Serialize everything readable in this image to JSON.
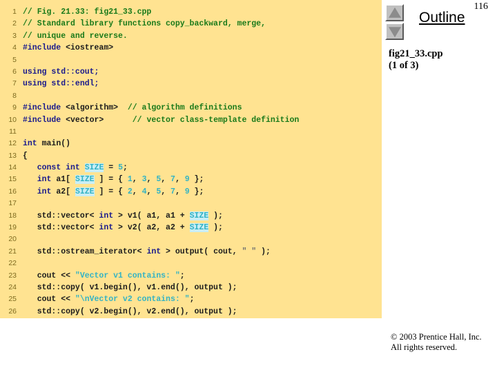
{
  "page_number": "116",
  "code_panel": {
    "background": "#ffe391",
    "lines": [
      {
        "n": "1",
        "segments": [
          {
            "t": "// Fig. 21.33: fig21_33.cpp",
            "c": "comment"
          }
        ]
      },
      {
        "n": "2",
        "segments": [
          {
            "t": "// Standard library functions copy_backward, merge,",
            "c": "comment"
          }
        ]
      },
      {
        "n": "3",
        "segments": [
          {
            "t": "// unique and reverse.",
            "c": "comment"
          }
        ]
      },
      {
        "n": "4",
        "segments": [
          {
            "t": "#include",
            "c": "pre"
          },
          {
            "t": " <iostream>",
            "c": "plain"
          }
        ]
      },
      {
        "n": "5",
        "segments": []
      },
      {
        "n": "6",
        "segments": [
          {
            "t": "using std::cout;",
            "c": "kw"
          }
        ]
      },
      {
        "n": "7",
        "segments": [
          {
            "t": "using std::endl;",
            "c": "kw"
          }
        ]
      },
      {
        "n": "8",
        "segments": []
      },
      {
        "n": "9",
        "segments": [
          {
            "t": "#include",
            "c": "pre"
          },
          {
            "t": " <algorithm>  ",
            "c": "plain"
          },
          {
            "t": "// algorithm definitions",
            "c": "comment"
          }
        ]
      },
      {
        "n": "10",
        "segments": [
          {
            "t": "#include",
            "c": "pre"
          },
          {
            "t": " <vector>      ",
            "c": "plain"
          },
          {
            "t": "// vector class-template definition",
            "c": "comment"
          }
        ]
      },
      {
        "n": "11",
        "segments": []
      },
      {
        "n": "12",
        "segments": [
          {
            "t": "int",
            "c": "kw"
          },
          {
            "t": " main()",
            "c": "plain"
          }
        ]
      },
      {
        "n": "13",
        "segments": [
          {
            "t": "{",
            "c": "plain"
          }
        ]
      },
      {
        "n": "14",
        "segments": [
          {
            "t": "   ",
            "c": "plain"
          },
          {
            "t": "const int",
            "c": "kw"
          },
          {
            "t": " ",
            "c": "plain"
          },
          {
            "t": "SIZE",
            "c": "hl"
          },
          {
            "t": " = ",
            "c": "plain"
          },
          {
            "t": "5",
            "c": "num"
          },
          {
            "t": ";",
            "c": "plain"
          }
        ]
      },
      {
        "n": "15",
        "segments": [
          {
            "t": "   ",
            "c": "plain"
          },
          {
            "t": "int",
            "c": "kw"
          },
          {
            "t": " a1[ ",
            "c": "plain"
          },
          {
            "t": "SIZE",
            "c": "hl"
          },
          {
            "t": " ] = { ",
            "c": "plain"
          },
          {
            "t": "1",
            "c": "num"
          },
          {
            "t": ", ",
            "c": "plain"
          },
          {
            "t": "3",
            "c": "num"
          },
          {
            "t": ", ",
            "c": "plain"
          },
          {
            "t": "5",
            "c": "num"
          },
          {
            "t": ", ",
            "c": "plain"
          },
          {
            "t": "7",
            "c": "num"
          },
          {
            "t": ", ",
            "c": "plain"
          },
          {
            "t": "9",
            "c": "num"
          },
          {
            "t": " };",
            "c": "plain"
          }
        ]
      },
      {
        "n": "16",
        "segments": [
          {
            "t": "   ",
            "c": "plain"
          },
          {
            "t": "int",
            "c": "kw"
          },
          {
            "t": " a2[ ",
            "c": "plain"
          },
          {
            "t": "SIZE",
            "c": "hl"
          },
          {
            "t": " ] = { ",
            "c": "plain"
          },
          {
            "t": "2",
            "c": "num"
          },
          {
            "t": ", ",
            "c": "plain"
          },
          {
            "t": "4",
            "c": "num"
          },
          {
            "t": ", ",
            "c": "plain"
          },
          {
            "t": "5",
            "c": "num"
          },
          {
            "t": ", ",
            "c": "plain"
          },
          {
            "t": "7",
            "c": "num"
          },
          {
            "t": ", ",
            "c": "plain"
          },
          {
            "t": "9",
            "c": "num"
          },
          {
            "t": " };",
            "c": "plain"
          }
        ]
      },
      {
        "n": "17",
        "segments": []
      },
      {
        "n": "18",
        "segments": [
          {
            "t": "   std::vector< ",
            "c": "plain"
          },
          {
            "t": "int",
            "c": "kw"
          },
          {
            "t": " > v1( a1, a1 + ",
            "c": "plain"
          },
          {
            "t": "SIZE",
            "c": "hl"
          },
          {
            "t": " );",
            "c": "plain"
          }
        ]
      },
      {
        "n": "19",
        "segments": [
          {
            "t": "   std::vector< ",
            "c": "plain"
          },
          {
            "t": "int",
            "c": "kw"
          },
          {
            "t": " > v2( a2, a2 + ",
            "c": "plain"
          },
          {
            "t": "SIZE",
            "c": "hl"
          },
          {
            "t": " );",
            "c": "plain"
          }
        ]
      },
      {
        "n": "20",
        "segments": []
      },
      {
        "n": "21",
        "segments": [
          {
            "t": "   std::ostream_iterator< ",
            "c": "plain"
          },
          {
            "t": "int",
            "c": "kw"
          },
          {
            "t": " > output( cout, ",
            "c": "plain"
          },
          {
            "t": "\" \"",
            "c": "strq"
          },
          {
            "t": " );",
            "c": "plain"
          }
        ]
      },
      {
        "n": "22",
        "segments": []
      },
      {
        "n": "23",
        "segments": [
          {
            "t": "   cout << ",
            "c": "plain"
          },
          {
            "t": "\"Vector v1 contains: \"",
            "c": "str"
          },
          {
            "t": ";",
            "c": "plain"
          }
        ]
      },
      {
        "n": "24",
        "segments": [
          {
            "t": "   std::copy( v1.begin(), v1.end(), output );",
            "c": "plain"
          }
        ]
      },
      {
        "n": "25",
        "segments": [
          {
            "t": "   cout << ",
            "c": "plain"
          },
          {
            "t": "\"\\nVector v2 contains: \"",
            "c": "str"
          },
          {
            "t": ";",
            "c": "plain"
          }
        ]
      },
      {
        "n": "26",
        "segments": [
          {
            "t": "   std::copy( v2.begin(), v2.end(), output );",
            "c": "plain"
          }
        ]
      }
    ]
  },
  "outline": {
    "title": "Outline",
    "file_name": "fig21_33.cpp",
    "file_part": "(1 of 3)",
    "scroll_up_icon": "triangle-up-icon",
    "scroll_down_icon": "triangle-down-icon"
  },
  "footer": {
    "line1": "© 2003 Prentice Hall, Inc.",
    "line2": "All rights reserved."
  }
}
